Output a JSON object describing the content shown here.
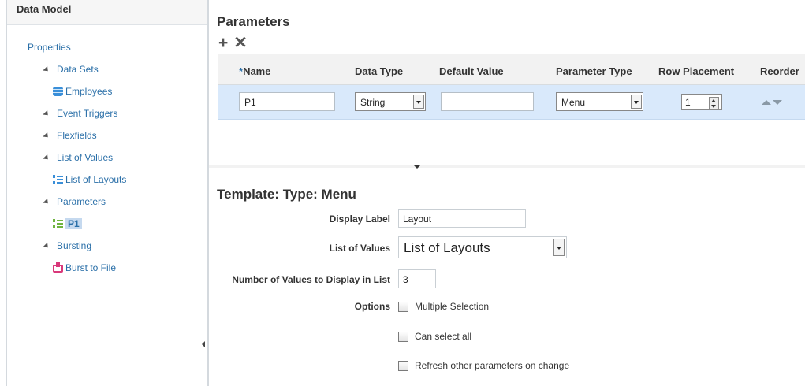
{
  "left_panel": {
    "title": "Data Model",
    "tree": {
      "properties": "Properties",
      "data_sets": "Data Sets",
      "employees": "Employees",
      "event_triggers": "Event Triggers",
      "flexfields": "Flexfields",
      "list_of_values": "List of Values",
      "list_of_layouts": "List of Layouts",
      "parameters": "Parameters",
      "p1": "P1",
      "bursting": "Bursting",
      "burst_to_file": "Burst to File"
    }
  },
  "parameters": {
    "title": "Parameters",
    "toolbar": {
      "add_icon": "+",
      "delete_icon": "✕"
    },
    "columns": {
      "name_required_mark": "*",
      "name": "Name",
      "data_type": "Data Type",
      "default_value": "Default Value",
      "parameter_type": "Parameter Type",
      "row_placement": "Row Placement",
      "reorder": "Reorder"
    },
    "row": {
      "name": "P1",
      "data_type": "String",
      "default_value": "",
      "parameter_type": "Menu",
      "row_placement": "1"
    }
  },
  "template": {
    "title": "Template: Type: Menu",
    "display_label_label": "Display Label",
    "display_label_value": "Layout",
    "list_of_values_label": "List of Values",
    "list_of_values_value": "List of Layouts",
    "num_values_label": "Number of Values to Display in List",
    "num_values_value": "3",
    "options_label": "Options",
    "multiple_selection": "Multiple Selection",
    "can_select_all": "Can select all",
    "refresh_on_change": "Refresh other parameters on change"
  },
  "colors": {
    "link": "#2a6fa8",
    "row_selected": "#d9e9fb",
    "header_bg": "#f2f2f2"
  }
}
